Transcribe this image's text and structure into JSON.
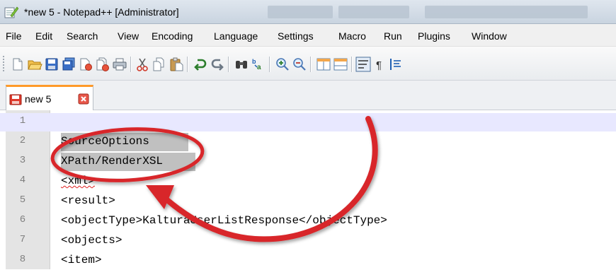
{
  "window": {
    "title": "*new  5 - Notepad++ [Administrator]"
  },
  "menu": {
    "items": [
      "File",
      "Edit",
      "Search",
      "View",
      "Encoding",
      "Language",
      "Settings",
      "Macro",
      "Run",
      "Plugins",
      "Window"
    ]
  },
  "toolbar": {
    "icons": [
      "new-file-icon",
      "open-file-icon",
      "save-icon",
      "save-all-icon",
      "close-icon",
      "close-all-icon",
      "print-icon",
      "cut-icon",
      "copy-icon",
      "paste-icon",
      "undo-icon",
      "redo-icon",
      "find-icon",
      "replace-icon",
      "zoom-in-icon",
      "zoom-out-icon",
      "sync-vertical-icon",
      "sync-horizontal-icon",
      "word-wrap-icon",
      "show-all-chars-icon",
      "indent-guide-icon"
    ]
  },
  "tab": {
    "label": "new  5"
  },
  "editor": {
    "lines": [
      {
        "number": "1",
        "text": ""
      },
      {
        "number": "2",
        "text": "SourceOptions"
      },
      {
        "number": "3",
        "text": "XPath/RenderXSL"
      },
      {
        "number": "4",
        "text": "<xml>"
      },
      {
        "number": "5",
        "text": "<result>"
      },
      {
        "number": "6",
        "text": "<objectType>KalturaUserListResponse</objectType>"
      },
      {
        "number": "7",
        "text": "<objects>"
      },
      {
        "number": "8",
        "text": "<item>"
      }
    ]
  },
  "colors": {
    "annotation": "#d8262a",
    "tab_accent": "#ff9a2a",
    "current_line": "#e8e8ff",
    "selection": "#c0c0c0"
  }
}
